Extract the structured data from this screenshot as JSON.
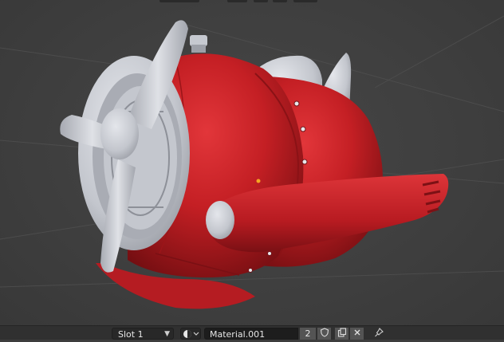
{
  "viewport": {
    "object": "cartoon-airplane",
    "body_color": "#c41f24",
    "accent_color": "#c9ccd3",
    "background_color": "#404040",
    "origin_color": "#f5a623"
  },
  "material_header": {
    "slot_label": "Slot 1",
    "material_name": "Material.001",
    "user_count": "2",
    "icons": {
      "slot_chevron": "chevron-down-icon",
      "browse": "material-sphere-icon",
      "fake_user": "shield-icon",
      "duplicate": "duplicate-icon",
      "unlink": "close-icon",
      "pin": "pin-icon"
    }
  }
}
